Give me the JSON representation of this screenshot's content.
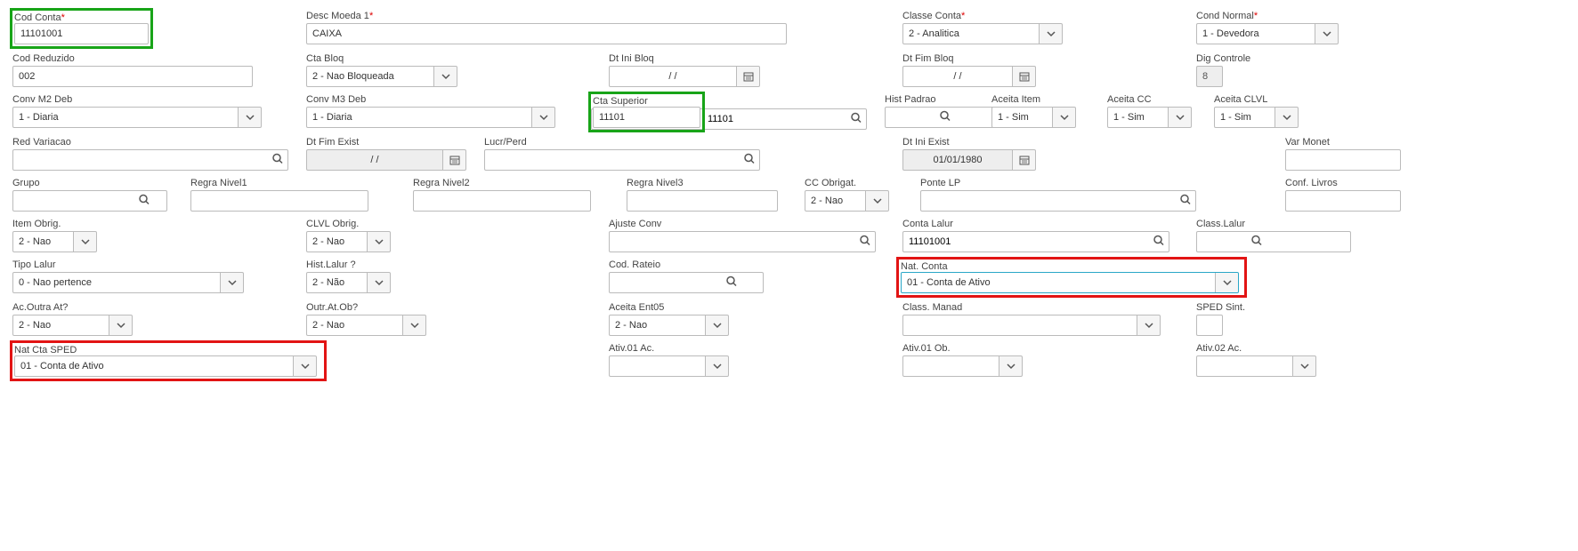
{
  "row1": {
    "cod_conta": {
      "label": "Cod Conta",
      "value": "11101001",
      "required": true
    },
    "desc_moeda1": {
      "label": "Desc Moeda 1",
      "value": "CAIXA",
      "required": true
    },
    "classe_conta": {
      "label": "Classe Conta",
      "value": "2 - Analitica",
      "required": true
    },
    "cond_normal": {
      "label": "Cond Normal",
      "value": "1 - Devedora",
      "required": true
    }
  },
  "row2": {
    "cod_reduzido": {
      "label": "Cod Reduzido",
      "value": "002"
    },
    "cta_bloq": {
      "label": "Cta Bloq",
      "value": "2 - Nao Bloqueada"
    },
    "dt_ini_bloq": {
      "label": "Dt Ini Bloq",
      "value": "/  /"
    },
    "dt_fim_bloq": {
      "label": "Dt Fim Bloq",
      "value": "/  /"
    },
    "dig_controle": {
      "label": "Dig Controle",
      "value": "8"
    }
  },
  "row3": {
    "conv_m2_deb": {
      "label": "Conv M2 Deb",
      "value": "1 - Diaria"
    },
    "conv_m3_deb": {
      "label": "Conv M3 Deb",
      "value": "1 - Diaria"
    },
    "cta_superior": {
      "label": "Cta Superior",
      "value": "11101"
    },
    "hist_padrao": {
      "label": "Hist Padrao",
      "value": ""
    },
    "aceita_item": {
      "label": "Aceita Item",
      "value": "1 - Sim"
    },
    "aceita_cc": {
      "label": "Aceita CC",
      "value": "1 - Sim"
    },
    "aceita_clvl": {
      "label": "Aceita CLVL",
      "value": "1 - Sim"
    }
  },
  "row4": {
    "red_variacao": {
      "label": "Red Variacao",
      "value": ""
    },
    "dt_fim_exist": {
      "label": "Dt Fim Exist",
      "value": "/  /"
    },
    "lucr_perd": {
      "label": "Lucr/Perd",
      "value": ""
    },
    "dt_ini_exist": {
      "label": "Dt Ini Exist",
      "value": "01/01/1980"
    },
    "var_monet": {
      "label": "Var Monet",
      "value": ""
    }
  },
  "row5": {
    "grupo": {
      "label": "Grupo",
      "value": ""
    },
    "regra_nivel1": {
      "label": "Regra Nivel1",
      "value": ""
    },
    "regra_nivel2": {
      "label": "Regra Nivel2",
      "value": ""
    },
    "regra_nivel3": {
      "label": "Regra Nivel3",
      "value": ""
    },
    "cc_obrigat": {
      "label": "CC Obrigat.",
      "value": "2 - Nao"
    },
    "ponte_lp": {
      "label": "Ponte LP",
      "value": ""
    },
    "conf_livros": {
      "label": "Conf. Livros",
      "value": ""
    }
  },
  "row6": {
    "item_obrig": {
      "label": "Item Obrig.",
      "value": "2 - Nao"
    },
    "clvl_obrig": {
      "label": "CLVL Obrig.",
      "value": "2 - Nao"
    },
    "ajuste_conv": {
      "label": "Ajuste Conv",
      "value": ""
    },
    "conta_lalur": {
      "label": "Conta Lalur",
      "value": "11101001"
    },
    "class_lalur": {
      "label": "Class.Lalur",
      "value": ""
    }
  },
  "row7": {
    "tipo_lalur": {
      "label": "Tipo Lalur",
      "value": "0 - Nao pertence"
    },
    "hist_lalur": {
      "label": "Hist.Lalur ?",
      "value": "2 - Não"
    },
    "cod_rateio": {
      "label": "Cod. Rateio",
      "value": ""
    },
    "nat_conta": {
      "label": "Nat. Conta",
      "value": "01 - Conta de Ativo"
    }
  },
  "row8": {
    "ac_outra_at": {
      "label": "Ac.Outra At?",
      "value": "2 - Nao"
    },
    "outr_at_ob": {
      "label": "Outr.At.Ob?",
      "value": "2 - Nao"
    },
    "aceita_ent05": {
      "label": "Aceita Ent05",
      "value": "2 - Nao"
    },
    "class_manad": {
      "label": "Class. Manad",
      "value": ""
    },
    "sped_sint": {
      "label": "SPED Sint.",
      "value": ""
    }
  },
  "row9": {
    "nat_cta_sped": {
      "label": "Nat Cta SPED",
      "value": "01 - Conta de Ativo"
    },
    "ativ_01_ac": {
      "label": "Ativ.01 Ac.",
      "value": ""
    },
    "ativ_01_ob": {
      "label": "Ativ.01 Ob.",
      "value": ""
    },
    "ativ_02_ac": {
      "label": "Ativ.02 Ac.",
      "value": ""
    }
  }
}
